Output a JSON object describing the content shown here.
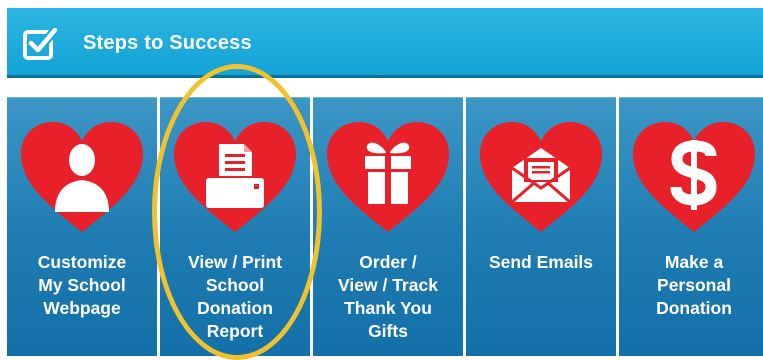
{
  "header": {
    "title": "Steps to Success",
    "icon": "checkbox-icon"
  },
  "colors": {
    "header_bg": "#1aaadc",
    "tile_bg": "#2586bb",
    "heart": "#e8202a",
    "highlight": "#f2c12e"
  },
  "tiles": [
    {
      "label": "Customize\nMy School\nWebpage",
      "icon": "person-icon"
    },
    {
      "label": "View / Print\nSchool\nDonation\nReport",
      "icon": "printer-icon"
    },
    {
      "label": "Order /\nView / Track\nThank You\nGifts",
      "icon": "gift-icon"
    },
    {
      "label": "Send Emails",
      "icon": "envelope-icon"
    },
    {
      "label": "Make a\nPersonal\nDonation",
      "icon": "dollar-icon"
    }
  ]
}
